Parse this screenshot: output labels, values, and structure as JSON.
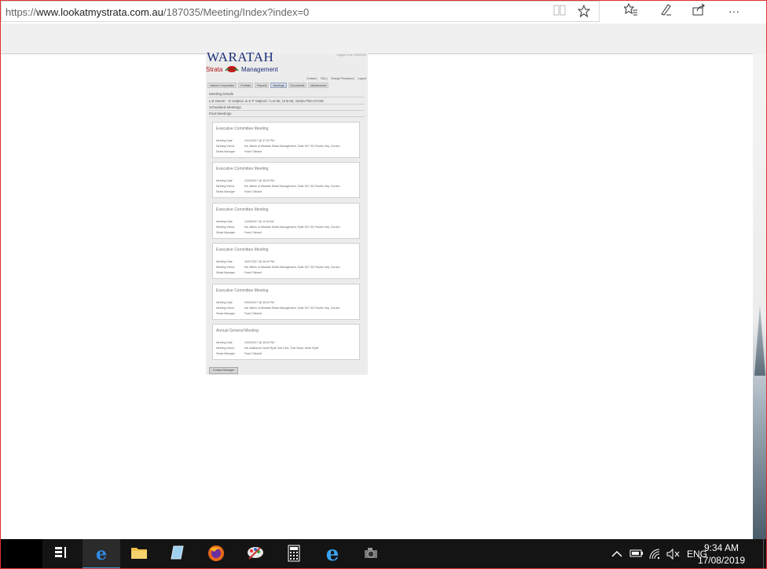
{
  "browser": {
    "url_scheme": "https://",
    "url_host": "www.lookatmystrata.com.au",
    "url_path": "/187035/Meeting/Index?index=0",
    "icons": [
      "reading-view-icon",
      "favorite-star-icon",
      "favorites-hub-icon",
      "pen-icon",
      "share-icon",
      "more-icon"
    ],
    "more_label": "···"
  },
  "site": {
    "logo_main": "WARATAH",
    "logo_strata": "Strata",
    "logo_management": "Management",
    "logged_in": "Logged in as: 00000000",
    "top_links": [
      "Contact",
      "FAQ",
      "Change Password",
      "Logout"
    ],
    "tabs": [
      "Owners Corporation",
      "Portfolio",
      "Reports",
      "Meetings",
      "Documents",
      "Maintenance"
    ],
    "active_tab": "Meetings",
    "section_title": "Meeting Details",
    "lot_owner": "Lot Owner - D Saljevic & S P Saljevic / Lot 65, Unit 65, Strata Plan 57446",
    "scheduled": "Scheduled Meetings",
    "past": "Past Meetings",
    "contact_button": "Contact Manager"
  },
  "meeting_labels": {
    "date": "Meeting Date",
    "venue": "Meeting Venue",
    "manager": "Strata Manager"
  },
  "meetings": [
    {
      "title": "Executive Committee Meeting",
      "date": "19/10/2017 @ 07:00 PM",
      "venue": "the offices of Waratah Strata Management, Suite 202 781 Pacific Hwy, Gordon",
      "manager": "Frank Tolbardi"
    },
    {
      "title": "Executive Committee Meeting",
      "date": "22/06/2017 @ 06:00 PM",
      "venue": "the offices of Waratah Strata Management, Suite 202 781 Pacific Hwy, Gordon",
      "manager": "Frank Tolbardi"
    },
    {
      "title": "Executive Committee Meeting",
      "date": "10/08/2017 @ 11:00 AM",
      "venue": "the offices of Waratah Strata Management, Suite 202 781 Pacific Hwy, Gordon",
      "manager": "Frank Tolbardi"
    },
    {
      "title": "Executive Committee Meeting",
      "date": "30/07/2017 @ 06:00 PM",
      "venue": "the offices of Waratah Strata Management, Suite 202 781 Pacific Hwy, Gordon",
      "manager": "Frank Tolbardi"
    },
    {
      "title": "Executive Committee Meeting",
      "date": "09/09/2017 @ 06:00 PM",
      "venue": "the offices of Waratah Strata Management, Suite 202 781 Pacific Hwy, Gordon",
      "manager": "Frank Tolbardi"
    },
    {
      "title": "Annual General Meeting",
      "date": "15/03/2017 @ 06:30 PM",
      "venue": "the auditorium North Ryde Golf Club, Twin Road, North Ryde",
      "manager": "Frank Tolbardi"
    }
  ],
  "taskbar": {
    "apps": [
      "task-view",
      "edge",
      "file-explorer",
      "notes",
      "firefox",
      "paint",
      "calculator",
      "internet-explorer",
      "camera"
    ],
    "active_app": "edge",
    "tray_icons": [
      "chevron-up-icon",
      "battery-icon",
      "wifi-icon",
      "volume-muted-icon"
    ],
    "language": "ENG",
    "time": "9:34 AM",
    "date": "17/08/2019"
  },
  "colors": {
    "logo_blue": "#1b2f7a",
    "logo_red": "#b01010",
    "taskbar": "#141414",
    "edge_blue": "#1f6fd0"
  }
}
